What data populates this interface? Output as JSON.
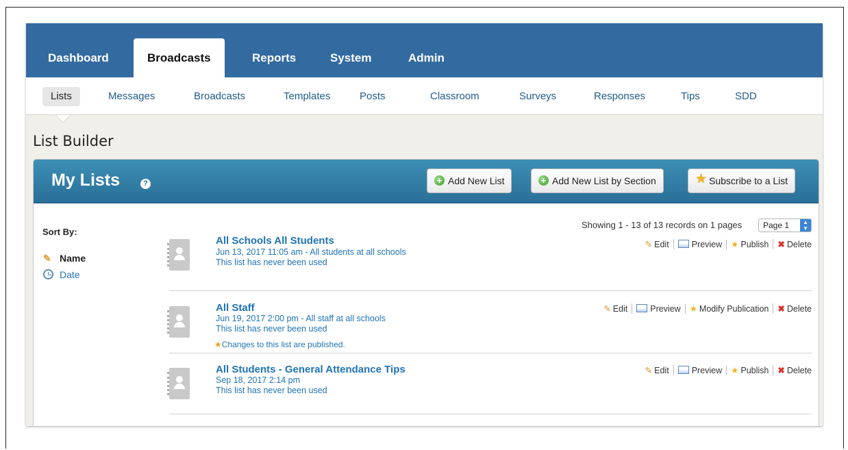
{
  "top_tabs": [
    {
      "label": "Dashboard"
    },
    {
      "label": "Broadcasts"
    },
    {
      "label": "Reports"
    },
    {
      "label": "System"
    },
    {
      "label": "Admin"
    }
  ],
  "sub_nav": [
    {
      "label": "Lists"
    },
    {
      "label": "Messages"
    },
    {
      "label": "Broadcasts"
    },
    {
      "label": "Templates"
    },
    {
      "label": "Posts"
    },
    {
      "label": "Classroom"
    },
    {
      "label": "Surveys"
    },
    {
      "label": "Responses"
    },
    {
      "label": "Tips"
    },
    {
      "label": "SDD"
    }
  ],
  "page_title": "List Builder",
  "panel": {
    "title": "My Lists",
    "help_glyph": "?",
    "buttons": {
      "add_new": "Add New List",
      "add_by_section": "Add New List by Section",
      "subscribe": "Subscribe to a List"
    }
  },
  "sort": {
    "label": "Sort By:",
    "name": "Name",
    "date": "Date"
  },
  "pagination": {
    "showing": "Showing 1 - 13 of 13 records on 1 pages",
    "page_value": "Page 1"
  },
  "lists": [
    {
      "title": "All Schools All Students",
      "meta": "Jun 13, 2017 11:05 am - All students at all schools",
      "usage": "This list has never been used",
      "actions": {
        "edit": "Edit",
        "preview": "Preview",
        "publish": "Publish",
        "delete": "Delete"
      }
    },
    {
      "title": "All Staff",
      "meta": "Jun 19, 2017 2:00 pm - All staff at all schools",
      "usage": "This list has never been used",
      "note": "Changes to this list are published.",
      "actions": {
        "edit": "Edit",
        "preview": "Preview",
        "publish": "Modify Publication",
        "delete": "Delete"
      }
    },
    {
      "title": "All Students - General Attendance Tips",
      "meta": "Sep 18, 2017 2:14 pm",
      "usage": "This list has never been used",
      "actions": {
        "edit": "Edit",
        "preview": "Preview",
        "publish": "Publish",
        "delete": "Delete"
      }
    }
  ],
  "colors": {
    "nav_blue": "#336ba0",
    "panel_header": "#2a6f97",
    "link_blue": "#1f73b7"
  },
  "icons": {
    "add": "plus-circle-icon",
    "subscribe": "star-icon",
    "edit": "pencil-icon",
    "preview": "window-icon",
    "publish": "star-plus-icon",
    "delete": "x-icon"
  }
}
